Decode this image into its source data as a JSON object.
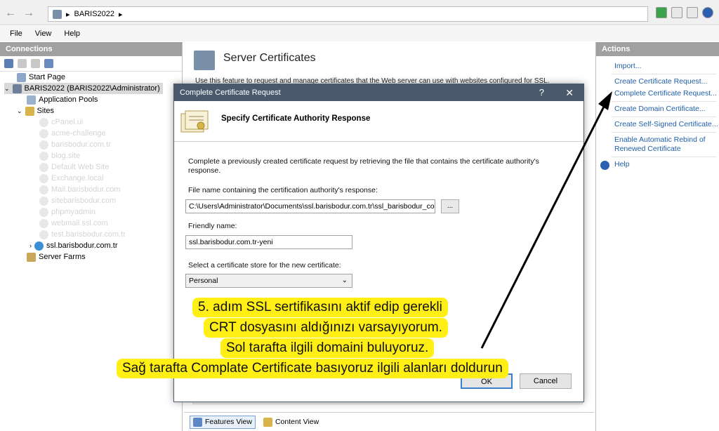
{
  "address": {
    "path": "BARIS2022",
    "separator_a": "▸",
    "separator_b": "▸"
  },
  "menu": {
    "file": "File",
    "view": "View",
    "help": "Help"
  },
  "connections": {
    "title": "Connections",
    "tree": {
      "start_page": "Start Page",
      "server": "BARIS2022 (BARIS2022\\Administrator)",
      "app_pools": "Application Pools",
      "sites": "Sites",
      "ghost_sites": [
        "cPanel.ui",
        "acme-challenge",
        "barisbodur.com.tr",
        "blog.site",
        "Default Web Site",
        "Exchange.local",
        "Mail.barisbodur.com",
        "sitebarisbodur.com",
        "phpmyadmin",
        "webmail.ssl.com",
        "test.barisbodur.com.tr"
      ],
      "ssl_site": "ssl.barisbodur.com.tr",
      "server_farms": "Server Farms"
    }
  },
  "middle": {
    "title": "Server Certificates",
    "description": "Use this feature to request and manage certificates that the Web server can use with websites configured for SSL.",
    "tab_features": "Features View",
    "tab_content": "Content View"
  },
  "actions": {
    "title": "Actions",
    "import": "Import...",
    "create_request": "Create Certificate Request...",
    "complete_request": "Complete Certificate Request...",
    "create_domain": "Create Domain Certificate...",
    "create_self_signed": "Create Self-Signed Certificate...",
    "rebind_1": "Enable Automatic Rebind of",
    "rebind_2": "Renewed Certificate",
    "help": "Help"
  },
  "dialog": {
    "title": "Complete Certificate Request",
    "help_glyph": "?",
    "close_glyph": "✕",
    "header": "Specify Certificate Authority Response",
    "intro_1": "Complete a previously created certificate request by retrieving the file that contains the certificate authority's",
    "intro_2": "response.",
    "file_label": "File name containing the certification authority's response:",
    "file_value": "C:\\Users\\Administrator\\Documents\\ssl.barisbodur.com.tr\\ssl_barisbodur_co",
    "browse": "...",
    "friendly_label": "Friendly name:",
    "friendly_value": "ssl.barisbodur.com.tr-yeni",
    "store_label": "Select a certificate store for the new certificate:",
    "store_value": "Personal",
    "ok": "OK",
    "cancel": "Cancel"
  },
  "annotation": {
    "line1": "5. adım SSL sertifikasını aktif edip gerekli",
    "line2": "CRT dosyasını aldığınızı varsayıyorum.",
    "line3": "Sol tarafta ilgili domaini buluyoruz.",
    "line4": "Sağ tarafta Complate Certificate basıyoruz ilgili alanları doldurun"
  },
  "icons": [
    "back-arrow-icon",
    "forward-arrow-icon",
    "server-icon",
    "refresh-icon",
    "help-icon",
    "certificate-icon"
  ]
}
